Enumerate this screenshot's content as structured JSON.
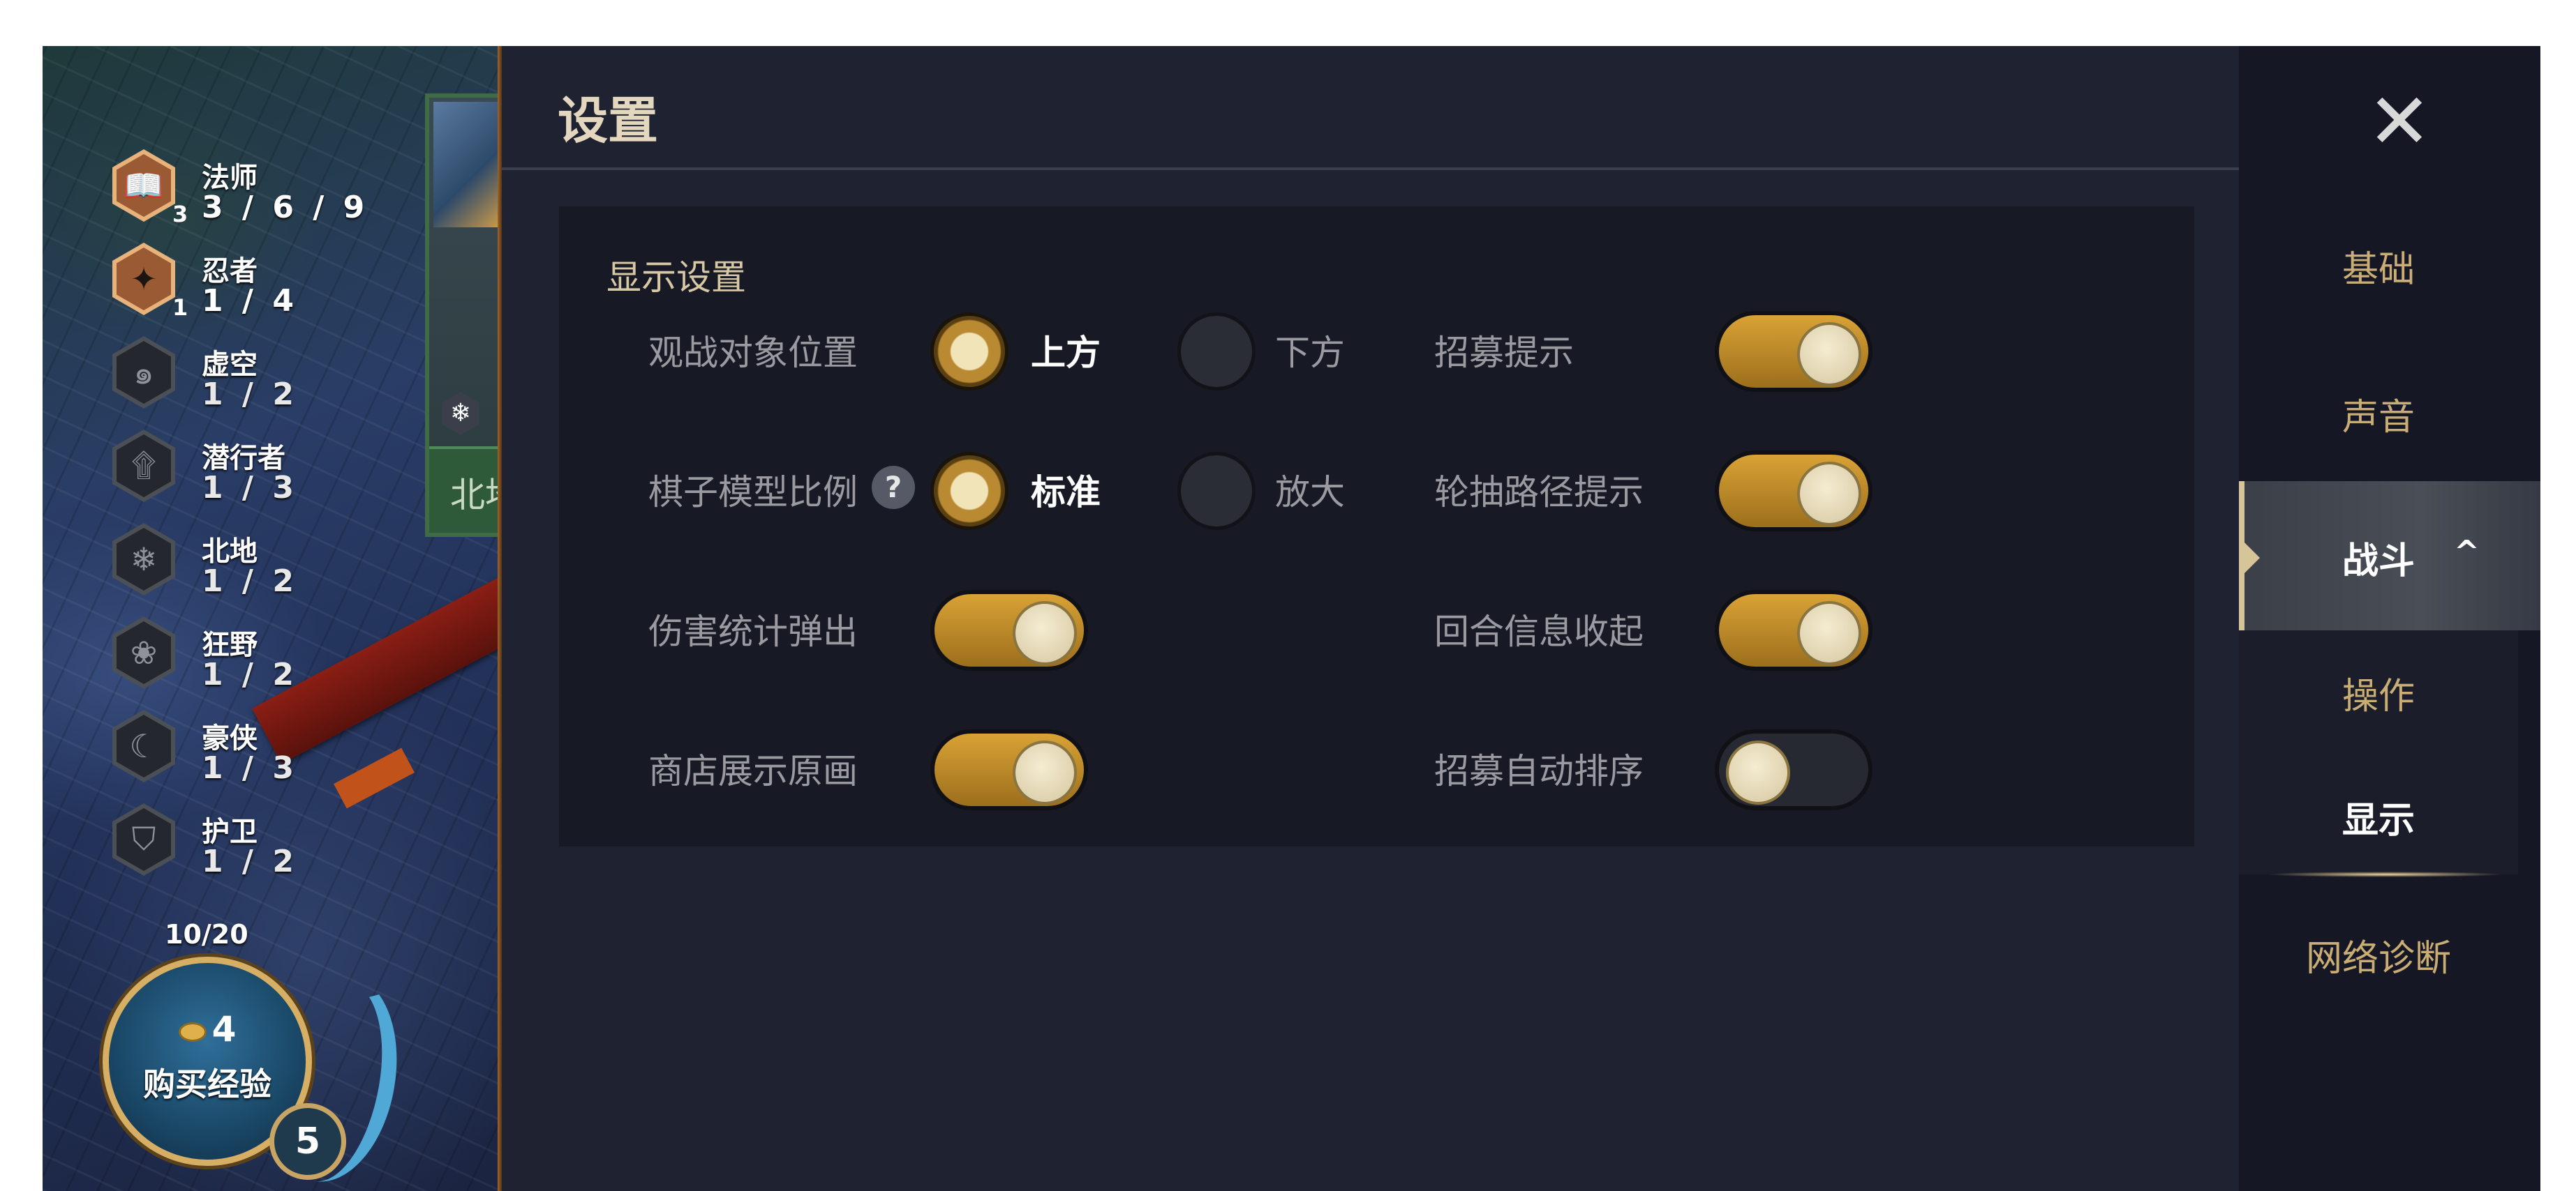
{
  "game": {
    "unit_card": {
      "name": "北地"
    },
    "traits": [
      {
        "icon": "mage-book-icon",
        "name": "法师",
        "count": "3 / 6 / 9",
        "tier": "3",
        "active": true,
        "glyph": "📖"
      },
      {
        "icon": "ninja-shuriken-icon",
        "name": "忍者",
        "count": "1 / 4",
        "tier": "1",
        "active": true,
        "glyph": "✦"
      },
      {
        "icon": "void-swirl-icon",
        "name": "虚空",
        "count": "1 / 2",
        "tier": "",
        "active": false,
        "glyph": "๑"
      },
      {
        "icon": "assassin-hood-icon",
        "name": "潜行者",
        "count": "1 / 3",
        "tier": "",
        "active": false,
        "glyph": "۩"
      },
      {
        "icon": "glacial-snowflake-icon",
        "name": "北地",
        "count": "1 / 2",
        "tier": "",
        "active": false,
        "glyph": "❄"
      },
      {
        "icon": "wild-paw-icon",
        "name": "狂野",
        "count": "1 / 2",
        "tier": "",
        "active": false,
        "glyph": "❀"
      },
      {
        "icon": "pirate-hat-icon",
        "name": "豪侠",
        "count": "1 / 3",
        "tier": "",
        "active": false,
        "glyph": "☾"
      },
      {
        "icon": "guardian-shield-icon",
        "name": "护卫",
        "count": "1 / 2",
        "tier": "",
        "active": false,
        "glyph": "⛉"
      }
    ],
    "xp": {
      "progress_text": "10/20",
      "progress_fraction": 0.5,
      "cost": "4",
      "label": "购买经验",
      "level": "5"
    }
  },
  "settings": {
    "title": "设置",
    "section_title": "显示设置",
    "spectate_position": {
      "label": "观战对象位置",
      "options": [
        {
          "label": "上方",
          "selected": true
        },
        {
          "label": "下方",
          "selected": false
        }
      ]
    },
    "model_scale": {
      "label": "棋子模型比例",
      "help": "?",
      "options": [
        {
          "label": "标准",
          "selected": true
        },
        {
          "label": "放大",
          "selected": false
        }
      ]
    },
    "damage_stats_popup": {
      "label": "伤害统计弹出",
      "on": true
    },
    "shop_show_art": {
      "label": "商店展示原画",
      "on": true
    },
    "recruit_hint": {
      "label": "招募提示",
      "on": true
    },
    "carousel_path_hint": {
      "label": "轮抽路径提示",
      "on": true
    },
    "round_info_collapse": {
      "label": "回合信息收起",
      "on": true
    },
    "recruit_auto_sort": {
      "label": "招募自动排序",
      "on": false
    }
  },
  "nav": {
    "close": "✕",
    "items": [
      "基础",
      "声音",
      "战斗",
      "操作",
      "显示",
      "网络诊断"
    ],
    "active": "战斗",
    "active_sub": "显示",
    "chevron": "^"
  },
  "colors": {
    "accent_gold": "#d9a235",
    "panel_bg": "#1f2231",
    "box_bg": "#171a25",
    "nav_text": "#c9ad74"
  }
}
